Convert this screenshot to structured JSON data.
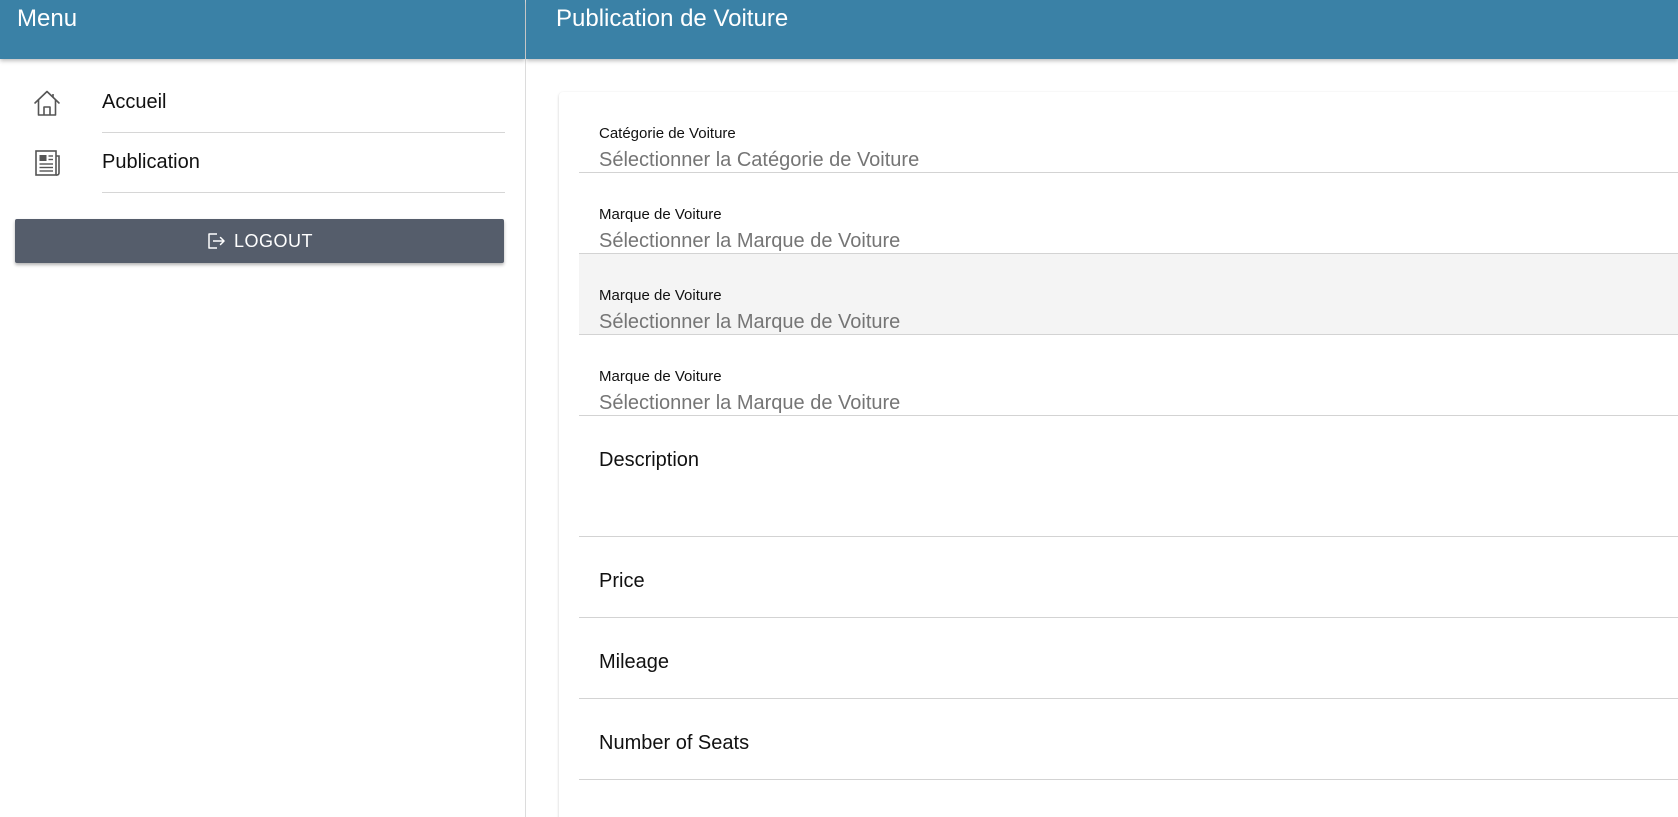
{
  "sidebar": {
    "title": "Menu",
    "items": [
      {
        "label": "Accueil",
        "icon": "home-icon"
      },
      {
        "label": "Publication",
        "icon": "newspaper-icon"
      }
    ],
    "logout_label": "LOGOUT",
    "logout_icon": "logout-icon"
  },
  "header": {
    "title": "Publication de Voiture"
  },
  "form": {
    "fields": [
      {
        "label": "Catégorie de Voiture",
        "value": "Sélectionner la Catégorie de Voiture"
      },
      {
        "label": "Marque de Voiture",
        "value": "Sélectionner la Marque de Voiture"
      },
      {
        "label": "Marque de Voiture",
        "value": "Sélectionner la Marque de Voiture"
      },
      {
        "label": "Marque de Voiture",
        "value": "Sélectionner la Marque de Voiture"
      }
    ],
    "description_label": "Description",
    "price_label": "Price",
    "mileage_label": "Mileage",
    "seats_label": "Number of Seats"
  },
  "colors": {
    "header_bg": "#3a81a6",
    "logout_bg": "#555d6b",
    "placeholder": "#757575",
    "active_field_bg": "#f4f4f4"
  }
}
